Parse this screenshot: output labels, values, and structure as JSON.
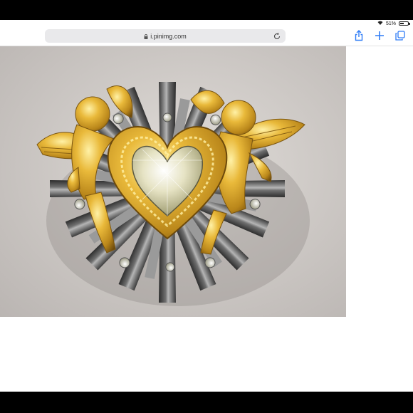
{
  "status_bar": {
    "battery_text": "51%",
    "battery_level": 0.51
  },
  "browser": {
    "url": "i.pinimg.com"
  },
  "icons": {
    "wifi": "wifi-icon",
    "battery": "battery-icon",
    "lock": "lock-icon",
    "reload": "reload-icon",
    "share": "share-icon",
    "new_tab": "plus-icon",
    "tabs": "tabs-icon"
  },
  "colors": {
    "accent": "#2f7cf6",
    "gold": "#d9a623",
    "silver": "#6b6b6b",
    "background": "#d3cfcc"
  }
}
